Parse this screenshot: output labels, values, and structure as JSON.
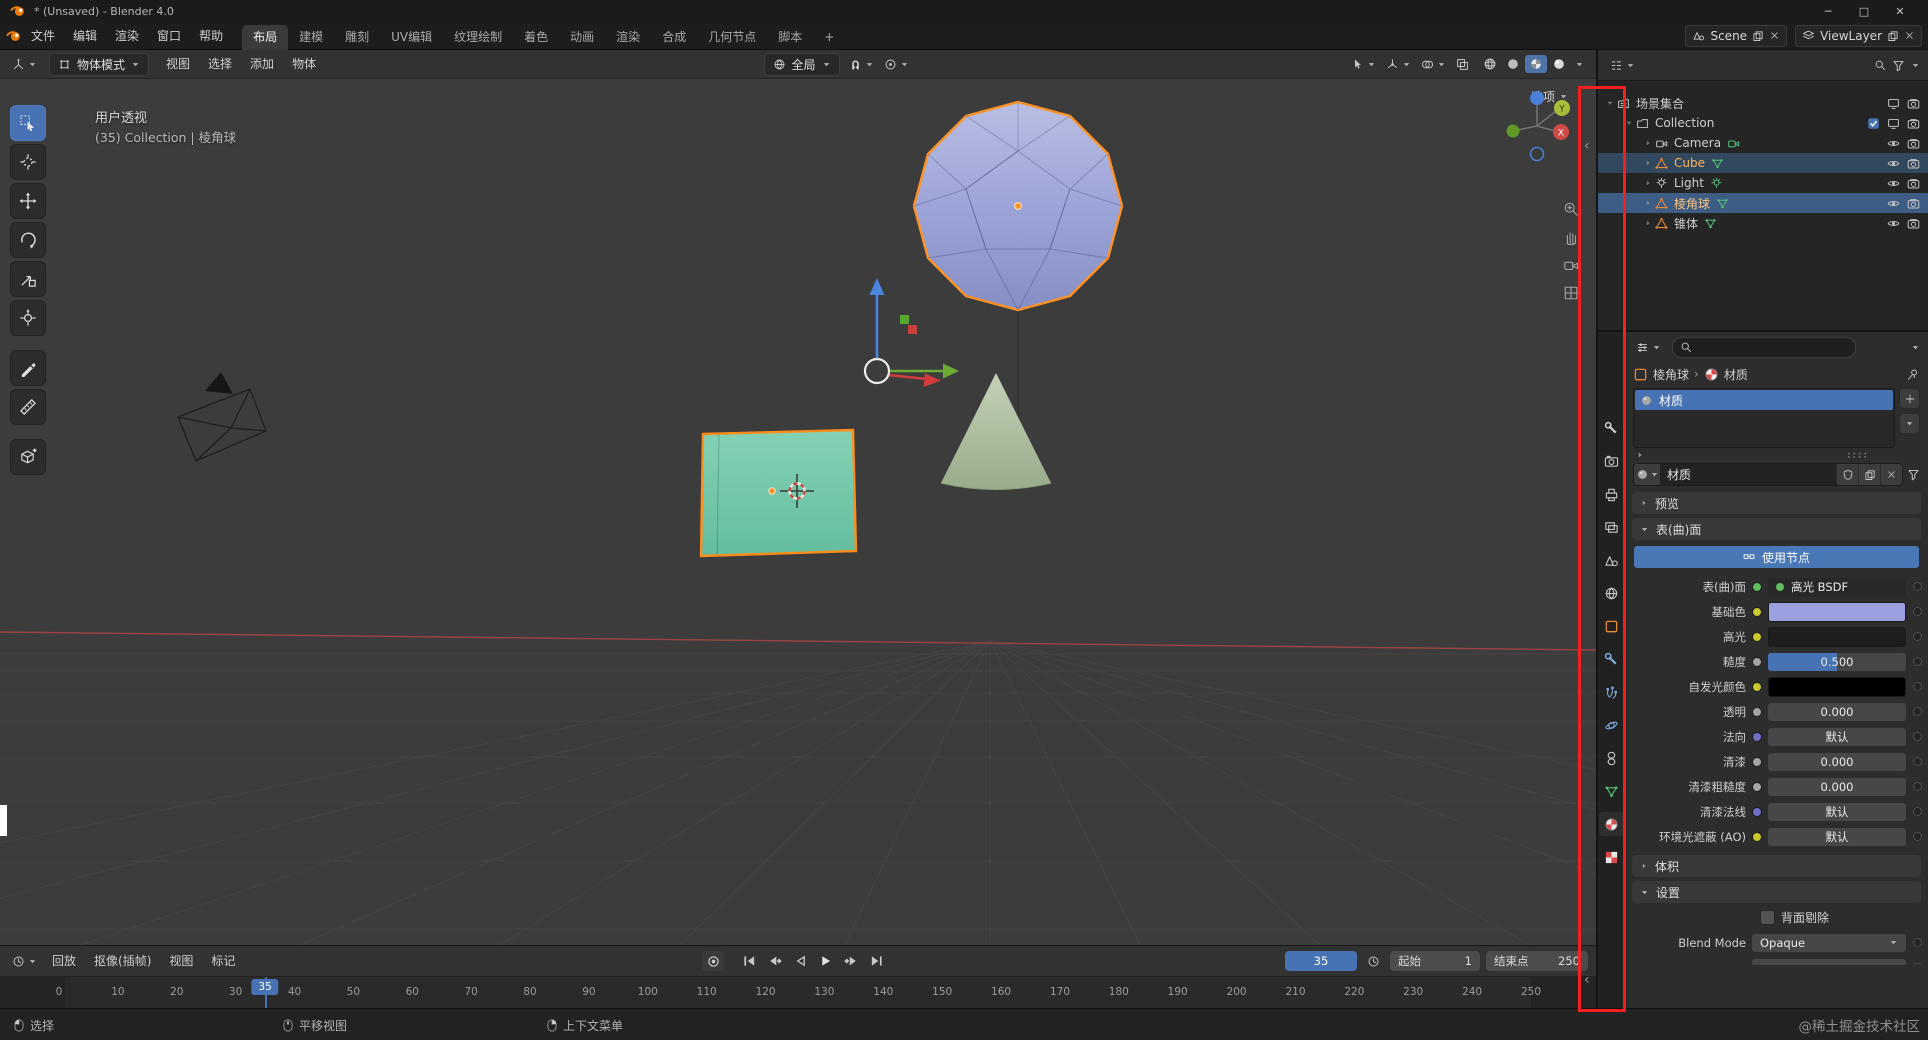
{
  "window": {
    "title": "* (Unsaved) - Blender 4.0",
    "controls": [
      "─",
      "□",
      "✕"
    ]
  },
  "topbar": {
    "menus": [
      "文件",
      "编辑",
      "渲染",
      "窗口",
      "帮助"
    ],
    "workspaces": [
      "布局",
      "建模",
      "雕刻",
      "UV编辑",
      "纹理绘制",
      "着色",
      "动画",
      "渲染",
      "合成",
      "几何节点",
      "脚本"
    ],
    "active_workspace": "布局",
    "add_workspace": "+",
    "scene": "Scene",
    "view_layer": "ViewLayer"
  },
  "viewport": {
    "header": {
      "mode": "物体模式",
      "menus": [
        "视图",
        "选择",
        "添加",
        "物体"
      ],
      "orientation": "全局"
    },
    "overlay": {
      "view_name": "用户透视",
      "context": "(35) Collection | 棱角球",
      "options_label": "选项"
    },
    "axis_x": "X",
    "axis_y": "Y",
    "side_icons": [
      "zoom-icon",
      "pan-hand-icon",
      "camera-view-icon",
      "toggle-ortho-icon"
    ],
    "shading_modes": [
      "wireframe",
      "solid",
      "material",
      "rendered"
    ],
    "active_shading": "material"
  },
  "toolbar": {
    "tools": [
      {
        "name": "tweak-select",
        "active": true
      },
      {
        "name": "cursor"
      },
      {
        "name": "move"
      },
      {
        "name": "rotate"
      },
      {
        "name": "scale"
      },
      {
        "name": "transform"
      },
      {
        "name": "annotate"
      },
      {
        "name": "measure"
      },
      {
        "name": "add-cube"
      }
    ]
  },
  "outliner": {
    "rows": [
      {
        "label": "场景集合",
        "type": "scene",
        "level": 0,
        "state": ""
      },
      {
        "label": "Collection",
        "type": "collection",
        "level": 1,
        "state": ""
      },
      {
        "label": "Camera",
        "type": "camera",
        "level": 2,
        "state": ""
      },
      {
        "label": "Cube",
        "type": "mesh",
        "level": 2,
        "state": "selected"
      },
      {
        "label": "Light",
        "type": "light",
        "level": 2,
        "state": ""
      },
      {
        "label": "棱角球",
        "type": "mesh",
        "level": 2,
        "state": "active"
      },
      {
        "label": "锥体",
        "type": "mesh",
        "level": 2,
        "state": ""
      }
    ]
  },
  "properties": {
    "tabs": [
      {
        "name": "tool"
      },
      {
        "name": "render"
      },
      {
        "name": "output"
      },
      {
        "name": "view-layer"
      },
      {
        "name": "scene"
      },
      {
        "name": "world"
      },
      {
        "name": "object"
      },
      {
        "name": "modifiers"
      },
      {
        "name": "particles"
      },
      {
        "name": "physics"
      },
      {
        "name": "constraints"
      },
      {
        "name": "object-data"
      },
      {
        "name": "material",
        "active": true
      },
      {
        "name": "texture"
      }
    ],
    "breadcrumb_object": "棱角球",
    "breadcrumb_separator": "›",
    "breadcrumb_data": "材质",
    "slots": [
      {
        "name": "材质",
        "selected": true
      }
    ],
    "datablock_name": "材质",
    "panels": {
      "preview": "预览",
      "surface": "表(曲)面",
      "volume": "体积",
      "settings": "设置"
    },
    "use_nodes": "使用节点",
    "surface_rows": [
      {
        "label": "表(曲)面",
        "widget": "shader",
        "value": "高光 BSDF",
        "socket": "#5fbd5f"
      },
      {
        "label": "基础色",
        "widget": "color",
        "color": "#9ba1e0",
        "socket": "#c9c92f"
      },
      {
        "label": "高光",
        "widget": "color",
        "color": "#1e1e1e",
        "socket": "#c9c92f"
      },
      {
        "label": "糙度",
        "widget": "slider",
        "value": "0.500",
        "fill": 0.5,
        "socket": "#a5a5a5"
      },
      {
        "label": "自发光颜色",
        "widget": "color",
        "color": "#000000",
        "socket": "#c9c92f"
      },
      {
        "label": "透明",
        "widget": "slider",
        "value": "0.000",
        "fill": 0,
        "socket": "#a5a5a5"
      },
      {
        "label": "法向",
        "widget": "field",
        "value": "默认",
        "socket": "#7070c9"
      },
      {
        "label": "清漆",
        "widget": "slider",
        "value": "0.000",
        "fill": 0,
        "socket": "#a5a5a5"
      },
      {
        "label": "清漆粗糙度",
        "widget": "slider",
        "value": "0.000",
        "fill": 0,
        "socket": "#a5a5a5"
      },
      {
        "label": "清漆法线",
        "widget": "field",
        "value": "默认",
        "socket": "#7070c9"
      },
      {
        "label": "环境光遮蔽 (AO)",
        "widget": "field",
        "value": "默认",
        "socket": "#c9c92f"
      }
    ],
    "settings": {
      "backface_label": "背面剔除",
      "blend_mode_label": "Blend Mode",
      "blend_mode_value": "Opaque"
    }
  },
  "timeline": {
    "menus": [
      "回放",
      "抠像(插帧)",
      "视图",
      "标记"
    ],
    "transport": [
      "jump-to-start",
      "jump-to-keyframe-prev",
      "play-reverse",
      "play",
      "jump-to-keyframe-next",
      "jump-to-end"
    ],
    "current_frame": "35",
    "start_label": "起始",
    "start_value": "1",
    "end_label": "结束点",
    "end_value": "250",
    "ruler_labels": [
      "0",
      "10",
      "20",
      "30",
      "40",
      "50",
      "60",
      "70",
      "80",
      "90",
      "100",
      "110",
      "120",
      "130",
      "140",
      "150",
      "160",
      "170",
      "180",
      "190",
      "200",
      "210",
      "220",
      "230",
      "240",
      "250"
    ]
  },
  "statusbar": {
    "items": [
      {
        "icon": "mouse-left",
        "label": "选择"
      },
      {
        "icon": "mouse-middle",
        "label": "平移视图"
      },
      {
        "icon": "mouse-right",
        "label": "上下文菜单"
      }
    ],
    "watermark": "@稀土掘金技术社区"
  }
}
